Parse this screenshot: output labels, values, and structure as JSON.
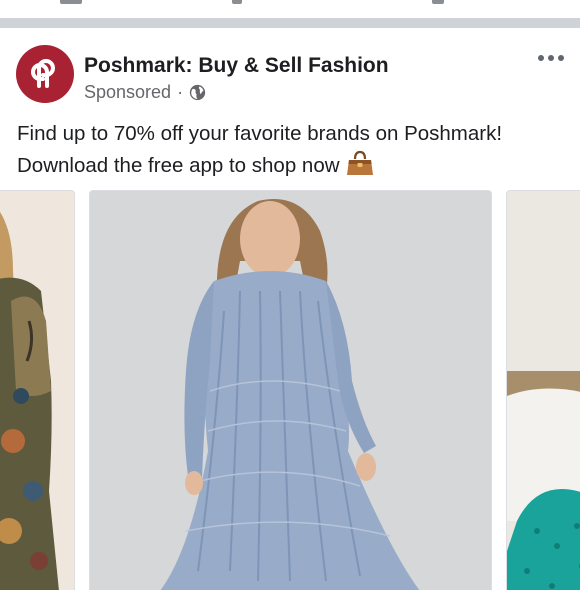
{
  "post": {
    "page_name": "Poshmark: Buy & Sell Fashion",
    "sponsored_label": "Sponsored",
    "meta_separator": "·",
    "text_line_1": "Find up to 70% off your favorite brands on Poshmark!",
    "text_line_2": "Download the free app to shop now",
    "brand_color": "#a82234"
  },
  "icons": {
    "avatar": "poshmark-logo-icon",
    "privacy": "globe-icon",
    "menu": "more-options-icon",
    "emoji": "handbag-icon"
  },
  "carousel": {
    "cards": [
      {
        "name": "floral-dress-photo"
      },
      {
        "name": "blue-embellished-dress-photo"
      },
      {
        "name": "teal-garment-photo"
      }
    ]
  }
}
